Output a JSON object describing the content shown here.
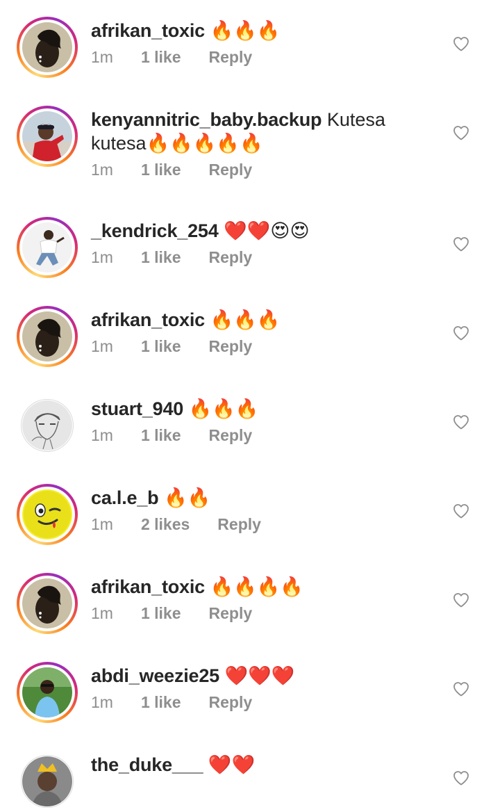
{
  "comments": [
    {
      "username": "afrikan_toxic",
      "text": "🔥🔥🔥",
      "time": "1m",
      "likes": "1 like",
      "reply": "Reply",
      "avatar": "africa-map-portrait",
      "ring": true
    },
    {
      "username": "kenyannitric_baby.backup",
      "text": "Kutesa kutesa🔥🔥🔥🔥🔥",
      "time": "1m",
      "likes": "1 like",
      "reply": "Reply",
      "avatar": "man-red-jacket-cap",
      "ring": true
    },
    {
      "username": "_kendrick_254",
      "text": "❤️❤️😍😍",
      "time": "1m",
      "likes": "1 like",
      "reply": "Reply",
      "avatar": "man-white-outfit",
      "ring": true
    },
    {
      "username": "afrikan_toxic",
      "text": "🔥🔥🔥",
      "time": "1m",
      "likes": "1 like",
      "reply": "Reply",
      "avatar": "africa-map-portrait",
      "ring": true
    },
    {
      "username": "stuart_940",
      "text": "🔥🔥🔥",
      "time": "1m",
      "likes": "1 like",
      "reply": "Reply",
      "avatar": "sketch-portrait",
      "ring": false
    },
    {
      "username": "ca.l.e_b",
      "text": "🔥🔥",
      "time": "1m",
      "likes": "2 likes",
      "reply": "Reply",
      "avatar": "winking-smiley",
      "ring": true
    },
    {
      "username": "afrikan_toxic",
      "text": "🔥🔥🔥🔥",
      "time": "1m",
      "likes": "1 like",
      "reply": "Reply",
      "avatar": "africa-map-portrait",
      "ring": true
    },
    {
      "username": "abdi_weezie25",
      "text": "❤️❤️❤️",
      "time": "1m",
      "likes": "1 like",
      "reply": "Reply",
      "avatar": "man-outdoors-green",
      "ring": true
    },
    {
      "username": "the_duke___",
      "text": "❤️❤️",
      "time": "",
      "likes": "",
      "reply": "",
      "avatar": "man-gold-crown",
      "ring": false
    }
  ],
  "icons": {
    "like": "heart-outline-icon"
  },
  "colors": {
    "text": "#262626",
    "meta": "#8e8e8e"
  }
}
